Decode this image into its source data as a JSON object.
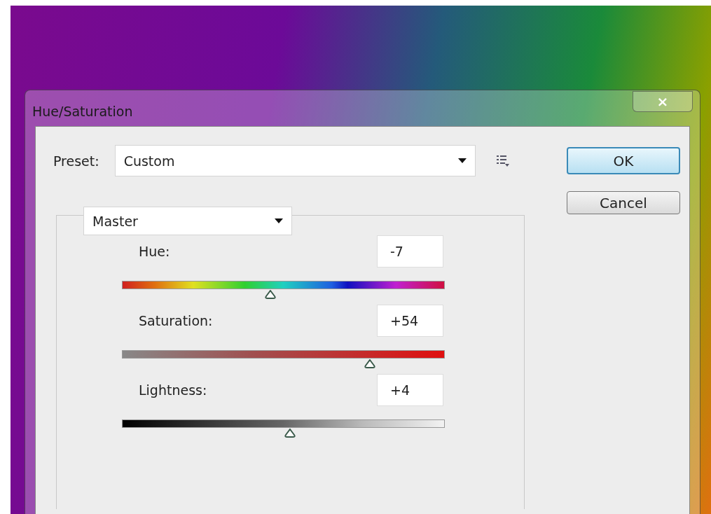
{
  "window": {
    "title": "Hue/Saturation",
    "close": "×"
  },
  "preset": {
    "label": "Preset:",
    "value": "Custom"
  },
  "buttons": [
    {
      "label": "OK",
      "default": true
    },
    {
      "label": "Cancel",
      "default": false
    }
  ],
  "channel": {
    "value": "Master"
  },
  "sliders": [
    {
      "kind": "hue",
      "label": "Hue:",
      "value": "-7",
      "level": 0.46
    },
    {
      "kind": "saturation",
      "label": "Saturation:",
      "value": "+54",
      "level": 0.77
    },
    {
      "kind": "lightness",
      "label": "Lightness:",
      "value": "+4",
      "level": 0.52
    }
  ]
}
